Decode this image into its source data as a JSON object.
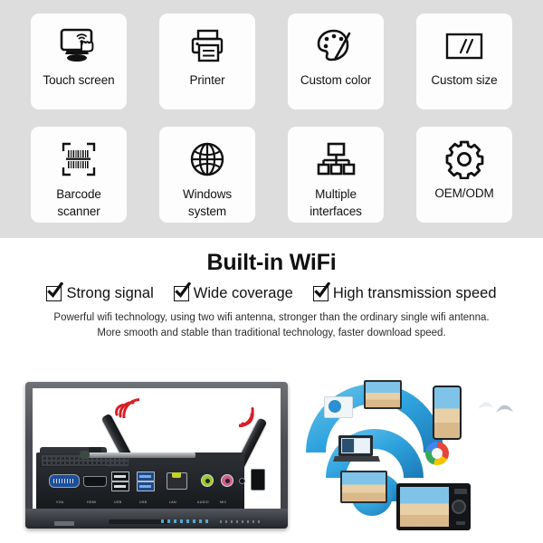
{
  "features": {
    "background_color": "#dddddd",
    "card_color": "#fdfdfd",
    "cards": [
      {
        "id": "touch-screen",
        "icon": "touch-screen-icon",
        "label": "Touch screen"
      },
      {
        "id": "printer",
        "icon": "printer-icon",
        "label": "Printer"
      },
      {
        "id": "custom-color",
        "icon": "paint-palette-icon",
        "label": "Custom color"
      },
      {
        "id": "custom-size",
        "icon": "screen-size-icon",
        "label": "Custom size"
      },
      {
        "id": "barcode-scanner",
        "icon": "barcode-scanner-icon",
        "label": "Barcode\nscanner",
        "line1": "Barcode",
        "line2": "scanner"
      },
      {
        "id": "windows-system",
        "icon": "globe-icon",
        "label": "Windows\nsystem",
        "line1": "Windows",
        "line2": "system"
      },
      {
        "id": "multiple-interfaces",
        "icon": "hierarchy-icon",
        "label": "Multiple\ninterfaces",
        "line1": "Multiple",
        "line2": "interfaces"
      },
      {
        "id": "oem-odm",
        "icon": "gear-icon",
        "label": "OEM/ODM"
      }
    ]
  },
  "wifi_section": {
    "headline": "Built-in WiFi",
    "checks": [
      {
        "label": "Strong signal"
      },
      {
        "label": "Wide coverage"
      },
      {
        "label": "High transmission speed"
      }
    ],
    "description_line1": "Powerful wifi technology, using two wifi antenna, stronger than the ordinary single wifi antenna.",
    "description_line2": "More smooth and stable than traditional technology, faster download speed."
  },
  "product_photo": {
    "device": "all-in-one-touch-monitor-rear-io",
    "antenna_count": 2,
    "signal_color": "#d81f26",
    "io_ports": [
      {
        "label": "VGA"
      },
      {
        "label": "HDMI"
      },
      {
        "label": "USB"
      },
      {
        "label": "USB"
      },
      {
        "label": "LAN"
      },
      {
        "label": "AUDIO"
      },
      {
        "label": "MIC"
      }
    ]
  },
  "wifi_illustration": {
    "accent_color": "#36a9e1",
    "devices": [
      "tablet",
      "smartphone",
      "laptop",
      "television",
      "digital-camera",
      "email",
      "browser"
    ]
  }
}
